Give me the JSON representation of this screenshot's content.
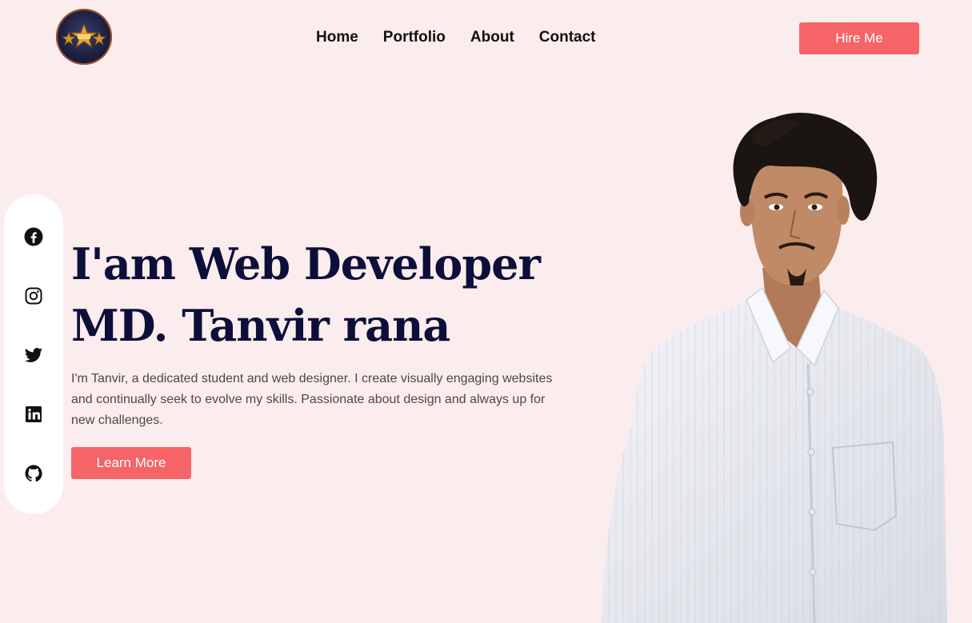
{
  "logo": {
    "icon": "star-badge-icon"
  },
  "nav": {
    "items": [
      "Home",
      "Portfolio",
      "About",
      "Contact"
    ]
  },
  "header": {
    "hire_label": "Hire Me"
  },
  "social": {
    "icons": [
      "facebook-icon",
      "instagram-icon",
      "twitter-icon",
      "linkedin-icon",
      "github-icon"
    ]
  },
  "hero": {
    "line1": "I'am Web Developer",
    "line2": "MD. Tanvir rana",
    "description": "I'm Tanvir, a dedicated student and web designer. I create visually engaging websites and continually seek to evolve my skills. Passionate about design and always up for new challenges.",
    "cta_label": "Learn More"
  },
  "colors": {
    "background": "#fbeced",
    "accent": "#f56466",
    "headline": "#0d0f3a"
  }
}
